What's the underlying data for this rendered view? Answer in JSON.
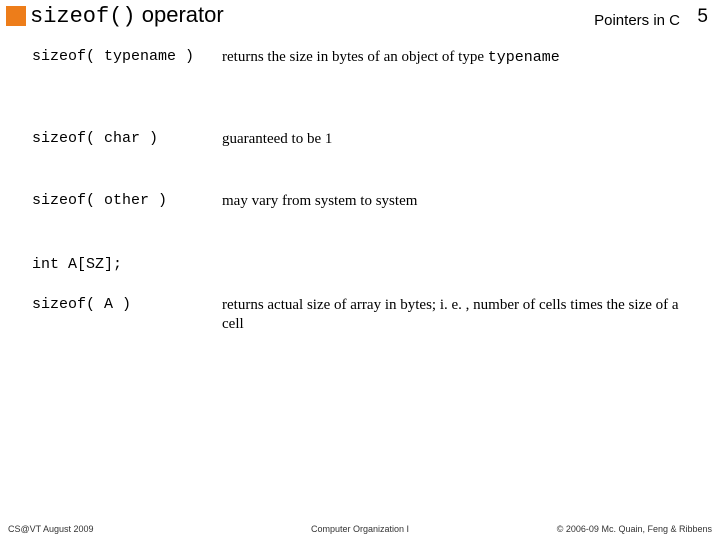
{
  "header": {
    "title_code": "sizeof()",
    "title_rest": " operator",
    "topic": "Pointers in C",
    "page_number": "5"
  },
  "rows": [
    {
      "lhs": "sizeof( typename )",
      "rhs_prefix": "returns the size in bytes of an object of type ",
      "rhs_code": "typename",
      "rhs_suffix": ""
    },
    {
      "lhs": "sizeof( char )",
      "rhs_prefix": "guaranteed to be 1",
      "rhs_code": "",
      "rhs_suffix": ""
    },
    {
      "lhs": "sizeof( other )",
      "rhs_prefix": "may vary from system to system",
      "rhs_code": "",
      "rhs_suffix": ""
    }
  ],
  "decl": "int A[SZ];",
  "array_row": {
    "lhs": "sizeof( A )",
    "rhs": " returns actual size of array in bytes; i. e. , number of cells times the size of a cell"
  },
  "footer": {
    "left": "CS@VT August 2009",
    "center": "Computer Organization I",
    "right": "© 2006-09 Mc. Quain, Feng & Ribbens"
  }
}
